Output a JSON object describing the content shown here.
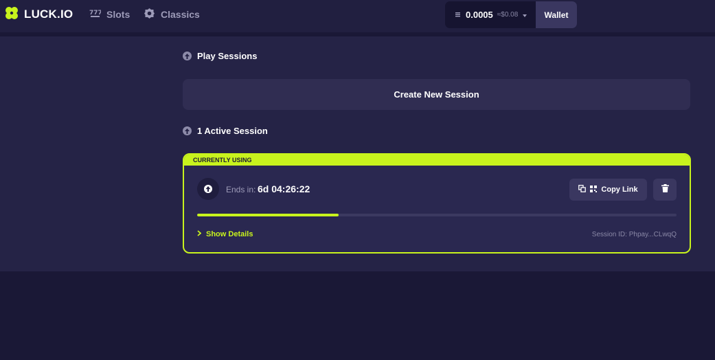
{
  "header": {
    "logo_text": "LUCK.IO",
    "nav": [
      {
        "label": "Slots",
        "icon": "slot-machine-icon"
      },
      {
        "label": "Classics",
        "icon": "gear-icon"
      }
    ],
    "balance": {
      "currency_icon": "coin-stack-icon",
      "amount": "0.0005",
      "usd": "≈$0.08"
    },
    "wallet_label": "Wallet"
  },
  "sessions": {
    "play_sessions_title": "Play Sessions",
    "create_button_label": "Create New Session",
    "active_title": "1 Active Session",
    "card": {
      "banner": "CURRENTLY USING",
      "ends_label": "Ends in:",
      "ends_value": "6d 04:26:22",
      "copy_label": "Copy Link",
      "progress": 0.295,
      "show_details_label": "Show Details",
      "session_id": "Session ID: Phpay...CLwqQ"
    }
  },
  "colors": {
    "accent": "#c8f31d",
    "background": "#1a1836",
    "panel": "#252346",
    "header": "#211f40"
  }
}
